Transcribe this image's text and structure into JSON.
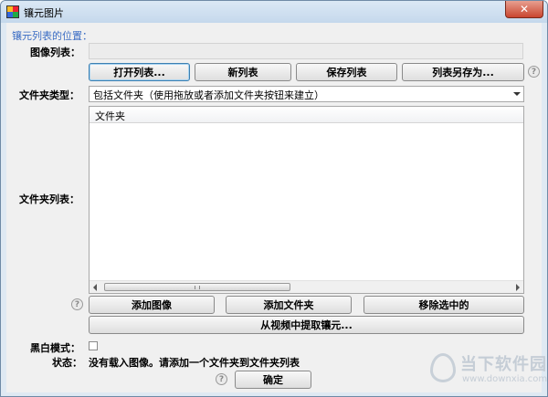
{
  "window": {
    "title": "镶元图片",
    "close_glyph": "✕"
  },
  "panel": {
    "section_title": "镶元列表的位置：",
    "image_list_label": "图像列表："
  },
  "list_buttons": {
    "open": "打开列表...",
    "new": "新列表",
    "save": "保存列表",
    "save_as": "列表另存为..."
  },
  "folder_type": {
    "label": "文件夹类型：",
    "selected": "包括文件夹（使用拖放或者添加文件夹按钮来建立）"
  },
  "folder_list": {
    "label": "文件夹列表：",
    "column_header": "文件夹"
  },
  "action_buttons": {
    "add_image": "添加图像",
    "add_folder": "添加文件夹",
    "remove_selected": "移除选中的",
    "extract_from_video": "从视频中提取镶元..."
  },
  "bw_mode": {
    "label": "黑白模式："
  },
  "status": {
    "label": "状态：",
    "text": "没有载入图像。请添加一个文件夹到文件夹列表"
  },
  "ok_button": "确定",
  "help_icon_glyph": "?",
  "watermark": {
    "title": "当下软件园",
    "url": "www.downxia.com"
  },
  "colors": {
    "section_title": "#3a6cc4",
    "window_frame": "#dfe9f3",
    "close_button": "#c9452f"
  }
}
